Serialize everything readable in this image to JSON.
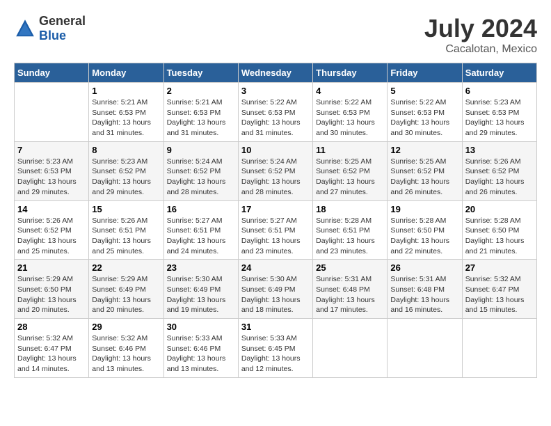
{
  "logo": {
    "general": "General",
    "blue": "Blue"
  },
  "title": "July 2024",
  "subtitle": "Cacalotan, Mexico",
  "headers": [
    "Sunday",
    "Monday",
    "Tuesday",
    "Wednesday",
    "Thursday",
    "Friday",
    "Saturday"
  ],
  "weeks": [
    [
      {
        "day": "",
        "info": ""
      },
      {
        "day": "1",
        "info": "Sunrise: 5:21 AM\nSunset: 6:53 PM\nDaylight: 13 hours\nand 31 minutes."
      },
      {
        "day": "2",
        "info": "Sunrise: 5:21 AM\nSunset: 6:53 PM\nDaylight: 13 hours\nand 31 minutes."
      },
      {
        "day": "3",
        "info": "Sunrise: 5:22 AM\nSunset: 6:53 PM\nDaylight: 13 hours\nand 31 minutes."
      },
      {
        "day": "4",
        "info": "Sunrise: 5:22 AM\nSunset: 6:53 PM\nDaylight: 13 hours\nand 30 minutes."
      },
      {
        "day": "5",
        "info": "Sunrise: 5:22 AM\nSunset: 6:53 PM\nDaylight: 13 hours\nand 30 minutes."
      },
      {
        "day": "6",
        "info": "Sunrise: 5:23 AM\nSunset: 6:53 PM\nDaylight: 13 hours\nand 29 minutes."
      }
    ],
    [
      {
        "day": "7",
        "info": "Sunrise: 5:23 AM\nSunset: 6:53 PM\nDaylight: 13 hours\nand 29 minutes."
      },
      {
        "day": "8",
        "info": "Sunrise: 5:23 AM\nSunset: 6:52 PM\nDaylight: 13 hours\nand 29 minutes."
      },
      {
        "day": "9",
        "info": "Sunrise: 5:24 AM\nSunset: 6:52 PM\nDaylight: 13 hours\nand 28 minutes."
      },
      {
        "day": "10",
        "info": "Sunrise: 5:24 AM\nSunset: 6:52 PM\nDaylight: 13 hours\nand 28 minutes."
      },
      {
        "day": "11",
        "info": "Sunrise: 5:25 AM\nSunset: 6:52 PM\nDaylight: 13 hours\nand 27 minutes."
      },
      {
        "day": "12",
        "info": "Sunrise: 5:25 AM\nSunset: 6:52 PM\nDaylight: 13 hours\nand 26 minutes."
      },
      {
        "day": "13",
        "info": "Sunrise: 5:26 AM\nSunset: 6:52 PM\nDaylight: 13 hours\nand 26 minutes."
      }
    ],
    [
      {
        "day": "14",
        "info": "Sunrise: 5:26 AM\nSunset: 6:52 PM\nDaylight: 13 hours\nand 25 minutes."
      },
      {
        "day": "15",
        "info": "Sunrise: 5:26 AM\nSunset: 6:51 PM\nDaylight: 13 hours\nand 25 minutes."
      },
      {
        "day": "16",
        "info": "Sunrise: 5:27 AM\nSunset: 6:51 PM\nDaylight: 13 hours\nand 24 minutes."
      },
      {
        "day": "17",
        "info": "Sunrise: 5:27 AM\nSunset: 6:51 PM\nDaylight: 13 hours\nand 23 minutes."
      },
      {
        "day": "18",
        "info": "Sunrise: 5:28 AM\nSunset: 6:51 PM\nDaylight: 13 hours\nand 23 minutes."
      },
      {
        "day": "19",
        "info": "Sunrise: 5:28 AM\nSunset: 6:50 PM\nDaylight: 13 hours\nand 22 minutes."
      },
      {
        "day": "20",
        "info": "Sunrise: 5:28 AM\nSunset: 6:50 PM\nDaylight: 13 hours\nand 21 minutes."
      }
    ],
    [
      {
        "day": "21",
        "info": "Sunrise: 5:29 AM\nSunset: 6:50 PM\nDaylight: 13 hours\nand 20 minutes."
      },
      {
        "day": "22",
        "info": "Sunrise: 5:29 AM\nSunset: 6:49 PM\nDaylight: 13 hours\nand 20 minutes."
      },
      {
        "day": "23",
        "info": "Sunrise: 5:30 AM\nSunset: 6:49 PM\nDaylight: 13 hours\nand 19 minutes."
      },
      {
        "day": "24",
        "info": "Sunrise: 5:30 AM\nSunset: 6:49 PM\nDaylight: 13 hours\nand 18 minutes."
      },
      {
        "day": "25",
        "info": "Sunrise: 5:31 AM\nSunset: 6:48 PM\nDaylight: 13 hours\nand 17 minutes."
      },
      {
        "day": "26",
        "info": "Sunrise: 5:31 AM\nSunset: 6:48 PM\nDaylight: 13 hours\nand 16 minutes."
      },
      {
        "day": "27",
        "info": "Sunrise: 5:32 AM\nSunset: 6:47 PM\nDaylight: 13 hours\nand 15 minutes."
      }
    ],
    [
      {
        "day": "28",
        "info": "Sunrise: 5:32 AM\nSunset: 6:47 PM\nDaylight: 13 hours\nand 14 minutes."
      },
      {
        "day": "29",
        "info": "Sunrise: 5:32 AM\nSunset: 6:46 PM\nDaylight: 13 hours\nand 13 minutes."
      },
      {
        "day": "30",
        "info": "Sunrise: 5:33 AM\nSunset: 6:46 PM\nDaylight: 13 hours\nand 13 minutes."
      },
      {
        "day": "31",
        "info": "Sunrise: 5:33 AM\nSunset: 6:45 PM\nDaylight: 13 hours\nand 12 minutes."
      },
      {
        "day": "",
        "info": ""
      },
      {
        "day": "",
        "info": ""
      },
      {
        "day": "",
        "info": ""
      }
    ]
  ]
}
